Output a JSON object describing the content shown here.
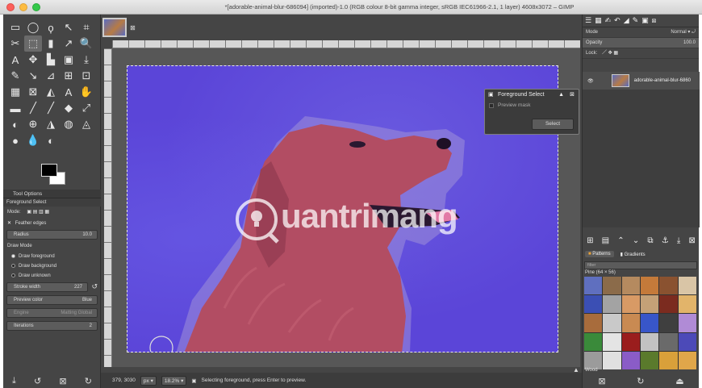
{
  "window": {
    "title": "*[adorable-animal-blur-686094] (imported)-1.0 (RGB colour 8-bit gamma integer, sRGB IEC61966-2.1, 1 layer) 4608x3072 – GIMP"
  },
  "toolbox": {
    "tools": [
      "▭",
      "◯",
      "ϙ",
      "↖",
      "⌗",
      "✂",
      "⬚",
      "▮",
      "↗",
      "🔍",
      "A",
      "✥",
      "▙",
      "▣",
      "⤓",
      "✎",
      "↘",
      "⊿",
      "⊞",
      "⊡",
      "▦",
      "⊠",
      "◭",
      "A",
      "✋",
      "▬",
      "╱",
      "╱",
      "◆",
      "⤢",
      "◐",
      "⊕",
      "◮",
      "◍",
      "◬",
      "●",
      "💧",
      "◐"
    ],
    "active_tool_index": 6
  },
  "tool_options": {
    "panel_title": "Tool Options",
    "tool_name": "Foreground Select",
    "mode_label": "Mode:",
    "feather_label": "Feather edges",
    "radius_label": "Radius",
    "radius_value": "10.0",
    "draw_mode_label": "Draw Mode",
    "draw_modes": [
      "Draw foreground",
      "Draw background",
      "Draw unknown"
    ],
    "stroke_label": "Stroke width",
    "stroke_value": "227",
    "preview_label": "Preview color",
    "preview_value": "Blue",
    "engine_label": "Engine",
    "engine_value": "Matting Global",
    "iterations_label": "Iterations",
    "iterations_value": "2"
  },
  "canvas": {
    "dialog": {
      "title": "Foreground Select",
      "preview_mask_label": "Preview mask",
      "select_button": "Select"
    },
    "watermark_text": "uantrimang",
    "status": {
      "coords": "379, 3030",
      "unit": "px",
      "zoom": "18.2%",
      "message": "Selecting foreground, press Enter to preview."
    }
  },
  "dock": {
    "mode_label": "Mode",
    "mode_value": "Normal",
    "opacity_label": "Opacity",
    "opacity_value": "100.0",
    "lock_label": "Lock:",
    "layer_name": "adorable-animal-blur-6860",
    "patterns_tab": "Patterns",
    "gradients_tab": "Gradients",
    "filter_placeholder": "filter",
    "pattern_name": "Pine (64 × 56)",
    "pattern_selected": "Wood",
    "pattern_colors": [
      "#5f6fbf",
      "#8b6b4a",
      "#b58a5f",
      "#c47a3a",
      "#8a5230",
      "#d9c5a6",
      "#3b4fb4",
      "#a3a3a3",
      "#d89a65",
      "#c4a177",
      "#7b2b1f",
      "#e2b46a",
      "#a86c3c",
      "#c9c9c9",
      "#c98a52",
      "#3856c9",
      "#3f3f3f",
      "#b08bd6",
      "#3a8a3a",
      "#e4e4e4",
      "#9a1d1d",
      "#c2c2c2",
      "#6a6a6a",
      "#4c4ab8",
      "#9b9b9b",
      "#e0e0e0",
      "#8a5cc7",
      "#5a7a2c",
      "#d9a03a",
      "#e0a64a"
    ]
  }
}
